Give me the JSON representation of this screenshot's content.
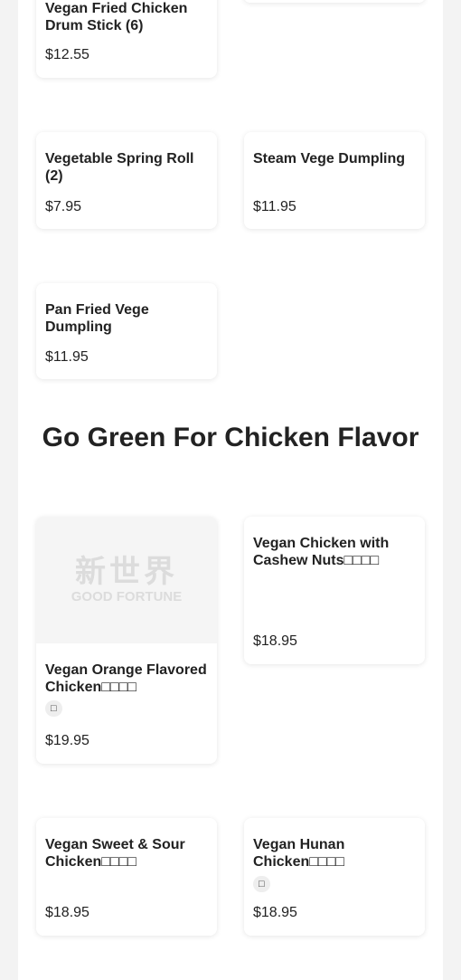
{
  "top_section": {
    "items": [
      {
        "name": "Vegan Fried Chicken Drum Stick (6)",
        "price": "$12.55"
      },
      {
        "name": "Vegetable Spring Roll (2)",
        "price": "$7.95"
      },
      {
        "name": "Steam Vege Dumpling",
        "price": "$11.95"
      },
      {
        "name": "Pan Fried Vege Dumpling",
        "price": "$11.95"
      }
    ]
  },
  "go_green_section": {
    "title": "Go Green For Chicken Flavor",
    "logo": {
      "chinese": "新世界",
      "english": "GOOD FORTUNE"
    },
    "items": [
      {
        "name": "Vegan Orange Flavored Chicken□□□□",
        "badge": "□",
        "price": "$19.95"
      },
      {
        "name": "Vegan Chicken with Cashew Nuts□□□□",
        "price": "$18.95"
      },
      {
        "name": "Vegan Sweet & Sour Chicken□□□□",
        "price": "$18.95"
      },
      {
        "name": "Vegan Hunan Chicken□□□□",
        "badge": "□",
        "price": "$18.95"
      }
    ]
  }
}
